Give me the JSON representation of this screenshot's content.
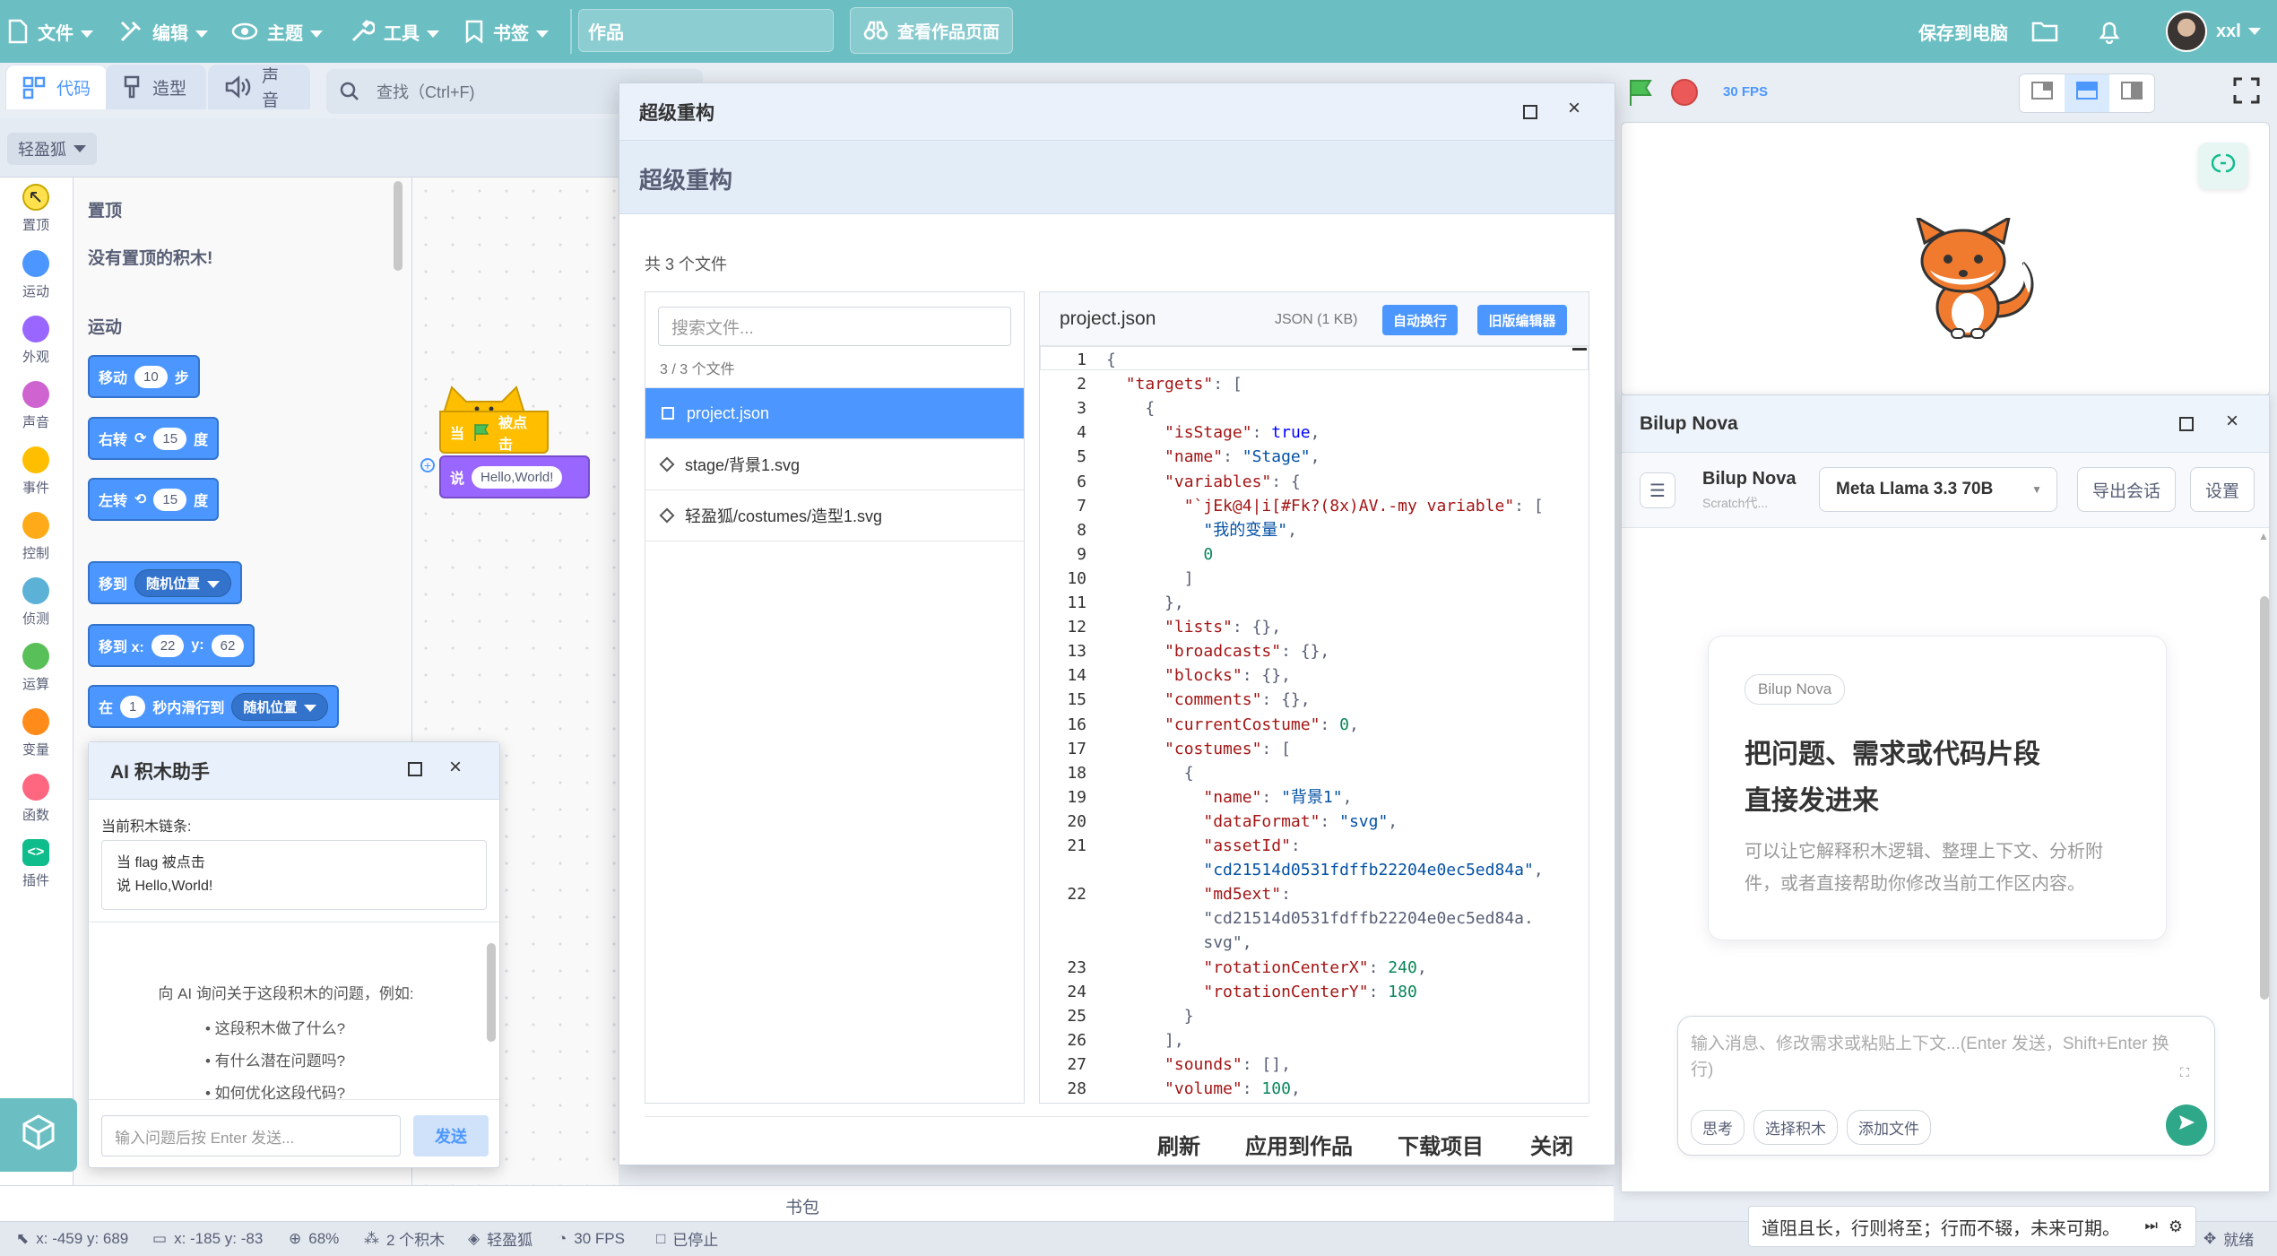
{
  "menu": {
    "file": "文件",
    "edit": "编辑",
    "theme": "主题",
    "tools": "工具",
    "bookmarks": "书签",
    "project_title": "作品",
    "view_project": "查看作品页面",
    "save": "保存到电脑",
    "user": "xxl"
  },
  "tabs": {
    "code": "代码",
    "costumes": "造型",
    "sounds": "声音"
  },
  "search": {
    "placeholder": "查找（Ctrl+F)"
  },
  "sprite_select": "轻盈狐",
  "stage_controls": {
    "fps": "30 FPS"
  },
  "categories": [
    "置顶",
    "运动",
    "外观",
    "声音",
    "事件",
    "控制",
    "侦测",
    "运算",
    "变量",
    "函数",
    "插件"
  ],
  "category_colors": [
    "#ffe14d",
    "#4c97ff",
    "#9966ff",
    "#cf63cf",
    "#ffbf00",
    "#ffab19",
    "#5cb1d6",
    "#59c059",
    "#ff8c1a",
    "#ff6680",
    "#0fbd8c"
  ],
  "palette": {
    "pinned_title": "置顶",
    "pinned_empty": "没有置顶的积木!",
    "motion_title": "运动",
    "move": "移动",
    "move_steps": "10",
    "steps": "步",
    "turn_right": "右转",
    "turn_right_deg": "15",
    "degrees": "度",
    "turn_left": "左转",
    "turn_left_deg": "15",
    "goto": "移到",
    "random_pos": "随机位置",
    "goto_x": "移到 x:",
    "x_val": "22",
    "y_label": "y:",
    "y_val": "62",
    "glide_in": "在",
    "glide_secs": "1",
    "glide_to": "秒内滑行到"
  },
  "script": {
    "when": "当",
    "clicked": "被点击",
    "say": "说",
    "say_text": "Hello,World!"
  },
  "ai_helper": {
    "title": "AI 积木助手",
    "chain_label": "当前积木链条:",
    "chain_line1": "当 flag 被点击",
    "chain_line2": "说 Hello,World!",
    "intro": "向 AI 询问关于这段积木的问题，例如:",
    "q1": "• 这段积木做了什么?",
    "q2": "• 有什么潜在问题吗?",
    "q3": "• 如何优化这段代码?",
    "input_placeholder": "输入问题后按 Enter 发送...",
    "send": "发送"
  },
  "backpack": "书包",
  "refactor": {
    "window_title": "超级重构",
    "header": "超级重构",
    "file_count": "共 3 个文件",
    "search_placeholder": "搜索文件...",
    "filtered": "3 / 3 个文件",
    "files": [
      "project.json",
      "stage/背景1.svg",
      "轻盈狐/costumes/造型1.svg"
    ],
    "open_file": "project.json",
    "file_meta": "JSON (1 KB)",
    "wrap_btn": "自动换行",
    "legacy_btn": "旧版编辑器",
    "refresh": "刷新",
    "apply": "应用到作品",
    "download": "下载项目",
    "close": "关闭"
  },
  "code_lines": [
    {
      "n": "1",
      "t": "{"
    },
    {
      "n": "2",
      "t": "  \"targets\": ["
    },
    {
      "n": "3",
      "t": "    {"
    },
    {
      "n": "4",
      "t": "      \"isStage\": true,"
    },
    {
      "n": "5",
      "t": "      \"name\": \"Stage\","
    },
    {
      "n": "6",
      "t": "      \"variables\": {"
    },
    {
      "n": "7",
      "t": "        \"`jEk@4|i[#Fk?(8x)AV.-my variable\": ["
    },
    {
      "n": "8",
      "t": "          \"我的变量\","
    },
    {
      "n": "9",
      "t": "          0"
    },
    {
      "n": "10",
      "t": "        ]"
    },
    {
      "n": "11",
      "t": "      },"
    },
    {
      "n": "12",
      "t": "      \"lists\": {},"
    },
    {
      "n": "13",
      "t": "      \"broadcasts\": {},"
    },
    {
      "n": "14",
      "t": "      \"blocks\": {},"
    },
    {
      "n": "15",
      "t": "      \"comments\": {},"
    },
    {
      "n": "16",
      "t": "      \"currentCostume\": 0,"
    },
    {
      "n": "17",
      "t": "      \"costumes\": ["
    },
    {
      "n": "18",
      "t": "        {"
    },
    {
      "n": "19",
      "t": "          \"name\": \"背景1\","
    },
    {
      "n": "20",
      "t": "          \"dataFormat\": \"svg\","
    },
    {
      "n": "21",
      "t": "          \"assetId\":"
    },
    {
      "n": "",
      "t": "          \"cd21514d0531fdffb22204e0ec5ed84a\","
    },
    {
      "n": "22",
      "t": "          \"md5ext\":"
    },
    {
      "n": "",
      "t": "          \"cd21514d0531fdffb22204e0ec5ed84a."
    },
    {
      "n": "",
      "t": "          svg\","
    },
    {
      "n": "23",
      "t": "          \"rotationCenterX\": 240,"
    },
    {
      "n": "24",
      "t": "          \"rotationCenterY\": 180"
    },
    {
      "n": "25",
      "t": "        }"
    },
    {
      "n": "26",
      "t": "      ],"
    },
    {
      "n": "27",
      "t": "      \"sounds\": [],"
    },
    {
      "n": "28",
      "t": "      \"volume\": 100,"
    }
  ],
  "nova": {
    "window_title": "Bilup Nova",
    "name": "Bilup Nova",
    "subtitle": "Scratch代...",
    "model": "Meta Llama 3.3 70B",
    "export": "导出会话",
    "settings": "设置",
    "badge": "Bilup Nova",
    "headline1": "把问题、需求或代码片段",
    "headline2": "直接发进来",
    "desc1": "可以让它解释积木逻辑、整理上下文、分析附",
    "desc2": "件，或者直接帮助你修改当前工作区内容。",
    "input_placeholder": "输入消息、修改需求或粘贴上下文...(Enter 发送，Shift+Enter 换行)",
    "think": "思考",
    "pick_blocks": "选择积木",
    "attach": "添加文件"
  },
  "status": {
    "mouse": "x: -459 y: 689",
    "stage_pos": "x: -185 y: -83",
    "zoom": "68%",
    "blocks": "2 个积木",
    "sprite": "轻盈狐",
    "fps": "30 FPS",
    "state": "已停止",
    "quote": "道阻且长，行则将至；行而不辍，未来可期。",
    "ready": "就绪"
  }
}
